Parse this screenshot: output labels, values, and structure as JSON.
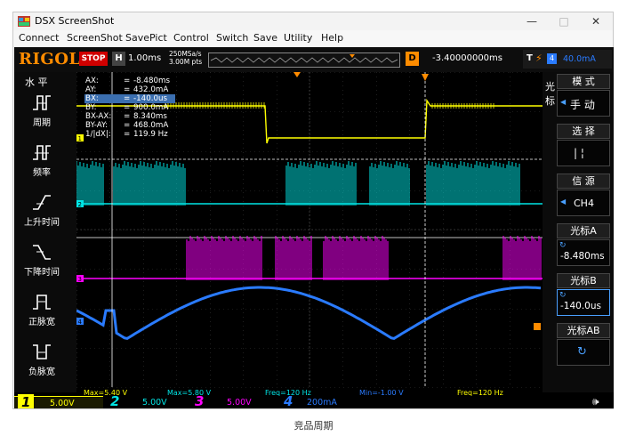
{
  "window": {
    "title": "DSX ScreenShot",
    "buttons": {
      "minimize": "—",
      "maximize": "□",
      "close": "✕"
    }
  },
  "menu": [
    "Connect",
    "ScreenShot",
    "SavePict",
    "Control",
    "Switch",
    "Save",
    "Utility",
    "Help"
  ],
  "scope": {
    "brand": "RIGOL",
    "run_state": "STOP",
    "horizontal": {
      "label": "H",
      "timebase": "1.00ms",
      "srate": "250MSa/s",
      "mem": "3.00M pts"
    },
    "delay": {
      "label": "D",
      "value": "-3.40000000ms"
    },
    "trigger": {
      "type": "T",
      "source": "4",
      "level": "40.0mA"
    },
    "left_menu": {
      "title": "水 平",
      "items": [
        {
          "label": "周期",
          "icon": "period-icon"
        },
        {
          "label": "频率",
          "icon": "frequency-icon"
        },
        {
          "label": "上升时间",
          "icon": "rise-time-icon"
        },
        {
          "label": "下降时间",
          "icon": "fall-time-icon"
        },
        {
          "label": "正脉宽",
          "icon": "positive-width-icon"
        },
        {
          "label": "负脉宽",
          "icon": "negative-width-icon"
        }
      ]
    },
    "cursor_info": [
      {
        "key": "AX:",
        "value": "-8.480ms"
      },
      {
        "key": "AY:",
        "value": "432.0mA"
      },
      {
        "key": "BX:",
        "value": "-140.0us",
        "selected": true
      },
      {
        "key": "BY:",
        "value": "900.0mA"
      },
      {
        "key": "BX-AX:",
        "value": "8.340ms"
      },
      {
        "key": "BY-AY:",
        "value": "468.0mA"
      },
      {
        "key": "1/|dX|:",
        "value": "119.9 Hz"
      }
    ],
    "right_menu": {
      "side_label": "光标",
      "mode_title": "模 式",
      "mode_value": "手 动",
      "select_title": "选 择",
      "select_value": "| ¦",
      "source_title": "信 源",
      "source_value": "CH4",
      "cursorA_title": "光标A",
      "cursorA_value": "-8.480ms",
      "cursorB_title": "光标B",
      "cursorB_value": "-140.0us",
      "cursorAB_title": "光标AB"
    },
    "measurements": [
      "Max=5.40 V",
      "Max=5.80 V",
      "Freq=120 Hz",
      "Min=-1.00 V",
      "Freq=120 Hz"
    ],
    "channels": [
      {
        "num": "1",
        "scale": "5.00V",
        "color": "#ffff00"
      },
      {
        "num": "2",
        "scale": "5.00V",
        "color": "#00e5e5"
      },
      {
        "num": "3",
        "scale": "5.00V",
        "color": "#ff00ff"
      },
      {
        "num": "4",
        "scale": "200mA",
        "color": "#2a7bff"
      }
    ]
  },
  "caption": "竞品周期"
}
